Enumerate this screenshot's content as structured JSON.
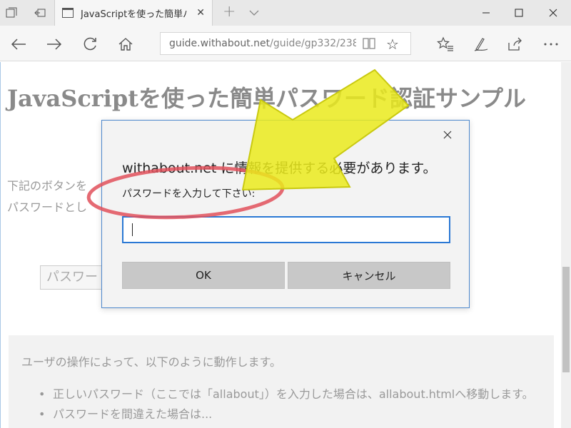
{
  "browser": {
    "tab_title": "JavaScriptを使った簡単パ",
    "address_domain": "guide.withabout.net",
    "address_path": "/guide/gp332/238"
  },
  "page": {
    "heading": "JavaScriptを使った簡単パスワード認証サンプル",
    "intro_line1": "下記のボタンを",
    "intro_line2": "パスワードとし",
    "button_label": "パスワード",
    "info_lead": "ユーザの操作によって、以下のように動作します。",
    "info_items": [
      "正しいパスワード（ここでは「allabout」）を入力した場合は、allabout.htmlへ移動します。",
      "パスワードを間違えた場合は..."
    ]
  },
  "dialog": {
    "message": "withabout.net に情報を提供する必要があります。",
    "prompt_label": "パスワードを入力して下さい:",
    "input_value": "",
    "ok_label": "OK",
    "cancel_label": "キャンセル"
  },
  "annotation": {
    "arrow_color": "#eaea1c",
    "ellipse_color": "#e0505a"
  },
  "colors": {
    "dialog_border": "#4d87cc",
    "input_focus": "#2a78d4",
    "heading": "#8a8a8a"
  }
}
